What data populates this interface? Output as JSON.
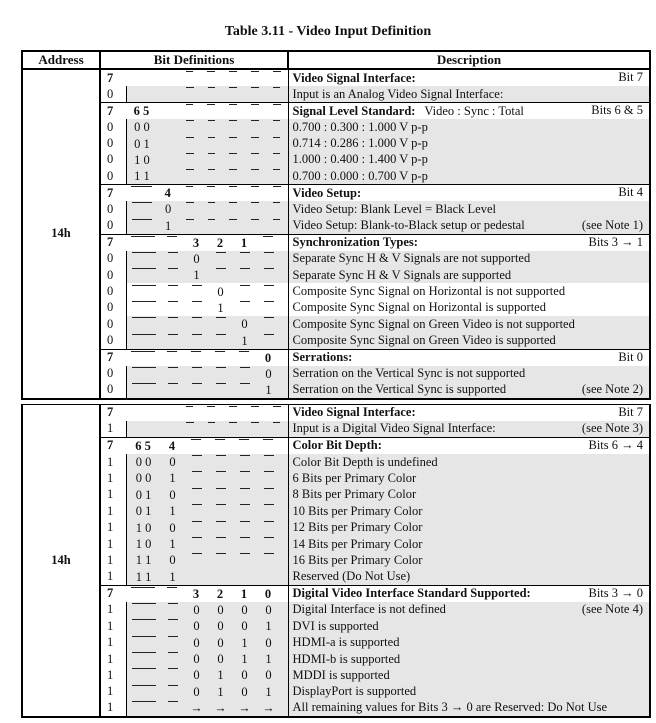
{
  "title": "Table 3.11 - Video Input Definition",
  "headers": {
    "address": "Address",
    "bits": "Bit Definitions",
    "description": "Description"
  },
  "analog": {
    "address": "14h",
    "rows": [
      {
        "type": "head",
        "b7": "7",
        "bits": [
          "",
          "",
          "_",
          "_",
          "_",
          "_",
          "_"
        ],
        "bold_bits": [],
        "desc": "Video Signal Interface:",
        "right": "Bit 7"
      },
      {
        "type": "val",
        "b7": "0",
        "bits": [
          "",
          "",
          "_",
          "_",
          "_",
          "_",
          "_"
        ],
        "desc": "Input is an Analog Video Signal Interface:",
        "right": "",
        "shade": true
      },
      {
        "type": "head",
        "b7": "7",
        "bits": [
          "6 5",
          "",
          "_",
          "_",
          "_",
          "_",
          "_"
        ],
        "desc": "Signal Level Standard:",
        "desc_extra": "Video : Sync : Total",
        "right": "Bits 6 & 5"
      },
      {
        "type": "val",
        "b7": "0",
        "bits": [
          "0 0",
          "",
          "_",
          "_",
          "_",
          "_",
          "_"
        ],
        "desc": "0.700 : 0.300 : 1.000 V p-p",
        "shade": true
      },
      {
        "type": "val",
        "b7": "0",
        "bits": [
          "0 1",
          "",
          "_",
          "_",
          "_",
          "_",
          "_"
        ],
        "desc": "0.714 : 0.286 : 1.000 V p-p",
        "shade": true
      },
      {
        "type": "val",
        "b7": "0",
        "bits": [
          "1 0",
          "",
          "_",
          "_",
          "_",
          "_",
          "_"
        ],
        "desc": "1.000 : 0.400 : 1.400 V p-p",
        "shade": true
      },
      {
        "type": "val",
        "b7": "0",
        "bits": [
          "1 1",
          "",
          "_",
          "_",
          "_",
          "_",
          "_"
        ],
        "desc": "0.700 : 0.000 : 0.700 V p-p",
        "shade": true
      },
      {
        "type": "head",
        "b7": "7",
        "bits": [
          "_ _",
          "4",
          "_",
          "_",
          "_",
          "_",
          "_"
        ],
        "desc": "Video Setup:",
        "right": "Bit 4"
      },
      {
        "type": "val",
        "b7": "0",
        "bits": [
          "_ _",
          "0",
          "_",
          "_",
          "_",
          "_",
          "_"
        ],
        "desc": "Video Setup: Blank Level = Black Level",
        "shade": true
      },
      {
        "type": "val",
        "b7": "0",
        "bits": [
          "_ _",
          "1",
          "_",
          "_",
          "_",
          "_",
          "_"
        ],
        "desc": "Video Setup: Blank-to-Black setup or pedestal",
        "right": "(see Note 1)",
        "shade": true
      },
      {
        "type": "head",
        "b7": "7",
        "bits": [
          "_ _",
          "_",
          "3",
          "2",
          "1",
          "_"
        ],
        "desc": "Synchronization Types:",
        "right": "Bits 3 → 1"
      },
      {
        "type": "val",
        "b7": "0",
        "bits": [
          "_ _",
          "_",
          "0",
          "_",
          "_",
          "_"
        ],
        "desc": "Separate Sync H & V Signals are not supported",
        "shade": true
      },
      {
        "type": "val",
        "b7": "0",
        "bits": [
          "_ _",
          "_",
          "1",
          "_",
          "_",
          "_"
        ],
        "desc": "Separate Sync H & V Signals are supported",
        "shade": true
      },
      {
        "type": "val",
        "b7": "0",
        "bits": [
          "_ _",
          "_",
          "_",
          "0",
          "_",
          "_"
        ],
        "desc": "Composite Sync Signal on Horizontal is not supported",
        "shade": false
      },
      {
        "type": "val",
        "b7": "0",
        "bits": [
          "_ _",
          "_",
          "_",
          "1",
          "_",
          "_"
        ],
        "desc": "Composite Sync Signal on Horizontal is supported",
        "shade": false
      },
      {
        "type": "val",
        "b7": "0",
        "bits": [
          "_ _",
          "_",
          "_",
          "_",
          "0",
          "_"
        ],
        "desc": "Composite Sync Signal on Green Video is not supported",
        "shade": true
      },
      {
        "type": "val",
        "b7": "0",
        "bits": [
          "_ _",
          "_",
          "_",
          "_",
          "1",
          "_"
        ],
        "desc": "Composite Sync Signal on Green Video is supported",
        "shade": true
      },
      {
        "type": "head",
        "b7": "7",
        "bits": [
          "_ _",
          "_",
          "_",
          "_",
          "_",
          "0"
        ],
        "desc": "Serrations:",
        "right": "Bit 0"
      },
      {
        "type": "val",
        "b7": "0",
        "bits": [
          "_ _",
          "_",
          "_",
          "_",
          "_",
          "0"
        ],
        "desc": "Serration on the Vertical Sync is not supported",
        "shade": true
      },
      {
        "type": "val",
        "b7": "0",
        "bits": [
          "_ _",
          "_",
          "_",
          "_",
          "_",
          "1"
        ],
        "desc": "Serration on the Vertical Sync is supported",
        "right": "(see Note 2)",
        "shade": true
      }
    ]
  },
  "digital": {
    "address": "14h",
    "rows": [
      {
        "type": "head",
        "b7": "7",
        "bits": [
          "",
          "",
          "_",
          "_",
          "_",
          "_",
          "_"
        ],
        "desc": "Video Signal Interface:",
        "right": "Bit 7"
      },
      {
        "type": "val",
        "b7": "1",
        "bits": [
          "",
          "",
          "_",
          "_",
          "_",
          "_",
          "_"
        ],
        "desc": "Input is a Digital Video Signal Interface:",
        "right": "(see Note 3)",
        "shade": true
      },
      {
        "type": "head",
        "b7": "7",
        "bits": [
          "6 5",
          "4",
          "_",
          "_",
          "_",
          "_"
        ],
        "desc": "Color Bit Depth:",
        "right": "Bits 6 → 4"
      },
      {
        "type": "val",
        "b7": "1",
        "bits": [
          "0 0",
          "0",
          "_",
          "_",
          "_",
          "_"
        ],
        "desc": "Color Bit Depth is undefined",
        "shade": true
      },
      {
        "type": "val",
        "b7": "1",
        "bits": [
          "0 0",
          "1",
          "_",
          "_",
          "_",
          "_"
        ],
        "desc": "6 Bits per Primary Color",
        "shade": true
      },
      {
        "type": "val",
        "b7": "1",
        "bits": [
          "0 1",
          "0",
          "_",
          "_",
          "_",
          "_"
        ],
        "desc": "8 Bits per Primary Color",
        "shade": true
      },
      {
        "type": "val",
        "b7": "1",
        "bits": [
          "0 1",
          "1",
          "_",
          "_",
          "_",
          "_"
        ],
        "desc": "10 Bits per Primary Color",
        "shade": true
      },
      {
        "type": "val",
        "b7": "1",
        "bits": [
          "1 0",
          "0",
          "_",
          "_",
          "_",
          "_"
        ],
        "desc": "12 Bits per Primary Color",
        "shade": true
      },
      {
        "type": "val",
        "b7": "1",
        "bits": [
          "1 0",
          "1",
          "_",
          "_",
          "_",
          "_"
        ],
        "desc": "14 Bits per Primary Color",
        "shade": true
      },
      {
        "type": "val",
        "b7": "1",
        "bits": [
          "1 1",
          "0",
          "_",
          "_",
          "_",
          "_"
        ],
        "desc": "16 Bits per Primary Color",
        "shade": true
      },
      {
        "type": "val",
        "b7": "1",
        "bits": [
          "1 1",
          "1",
          "",
          "",
          "",
          ""
        ],
        "desc": "Reserved (Do Not Use)",
        "shade": true
      },
      {
        "type": "head",
        "b7": "7",
        "bits": [
          "_ _",
          "_",
          "3",
          "2",
          "1",
          "0"
        ],
        "desc": "Digital Video Interface Standard Supported:",
        "right": "Bits 3 → 0"
      },
      {
        "type": "val",
        "b7": "1",
        "bits": [
          "_ _",
          "_",
          "0",
          "0",
          "0",
          "0"
        ],
        "desc": "Digital Interface is not defined",
        "right": "(see Note 4)",
        "shade": true
      },
      {
        "type": "val",
        "b7": "1",
        "bits": [
          "_ _",
          "_",
          "0",
          "0",
          "0",
          "1"
        ],
        "desc": "DVI is supported",
        "shade": true
      },
      {
        "type": "val",
        "b7": "1",
        "bits": [
          "_ _",
          "_",
          "0",
          "0",
          "1",
          "0"
        ],
        "desc": "HDMI-a is supported",
        "shade": true
      },
      {
        "type": "val",
        "b7": "1",
        "bits": [
          "_ _",
          "_",
          "0",
          "0",
          "1",
          "1"
        ],
        "desc": "HDMI-b is supported",
        "shade": true
      },
      {
        "type": "val",
        "b7": "1",
        "bits": [
          "_ _",
          "_",
          "0",
          "1",
          "0",
          "0"
        ],
        "desc": "MDDI is supported",
        "shade": true
      },
      {
        "type": "val",
        "b7": "1",
        "bits": [
          "_ _",
          "_",
          "0",
          "1",
          "0",
          "1"
        ],
        "desc": "DisplayPort is supported",
        "shade": true
      },
      {
        "type": "val",
        "b7": "1",
        "bits": [
          "_ _",
          "_",
          "→",
          "→",
          "→",
          "→"
        ],
        "desc": "All remaining values for Bits 3 → 0 are Reserved: Do Not Use",
        "shade": true
      }
    ]
  }
}
